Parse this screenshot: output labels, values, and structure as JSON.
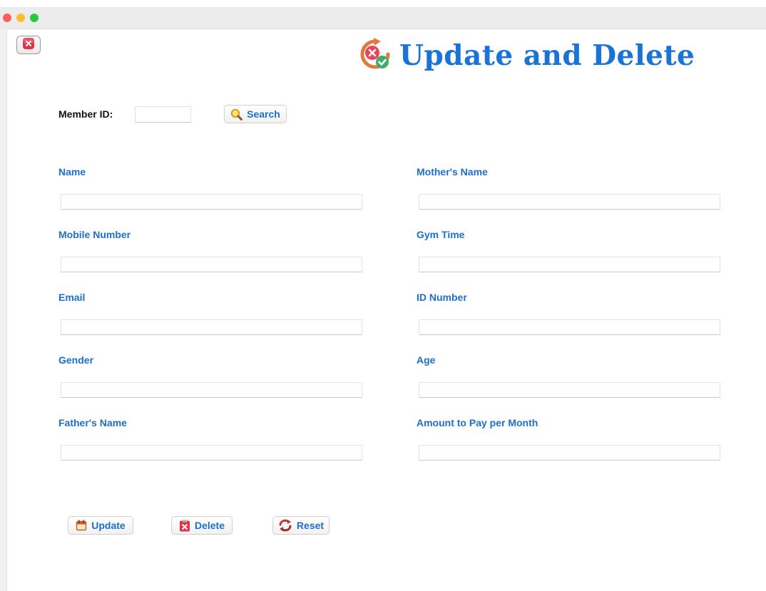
{
  "window": {
    "close_icon": "close-icon"
  },
  "header": {
    "title": "Update and Delete",
    "icon": "refresh-approve-reject-icon"
  },
  "search": {
    "member_id_label": "Member ID:",
    "member_id_value": "",
    "button_label": "Search",
    "icon": "magnifier-icon"
  },
  "form": {
    "left": [
      {
        "label": "Name",
        "value": ""
      },
      {
        "label": "Mobile Number",
        "value": ""
      },
      {
        "label": "Email",
        "value": ""
      },
      {
        "label": "Gender",
        "value": ""
      },
      {
        "label": "Father's Name",
        "value": ""
      }
    ],
    "right": [
      {
        "label": "Mother's Name",
        "value": ""
      },
      {
        "label": "Gym Time",
        "value": ""
      },
      {
        "label": "ID Number",
        "value": ""
      },
      {
        "label": "Age",
        "value": ""
      },
      {
        "label": "Amount to Pay per Month",
        "value": ""
      }
    ]
  },
  "actions": {
    "update_label": "Update",
    "delete_label": "Delete",
    "reset_label": "Reset"
  },
  "colors": {
    "accent": "#1b6fcf",
    "title": "#1a73d6",
    "danger": "#e0334a"
  }
}
